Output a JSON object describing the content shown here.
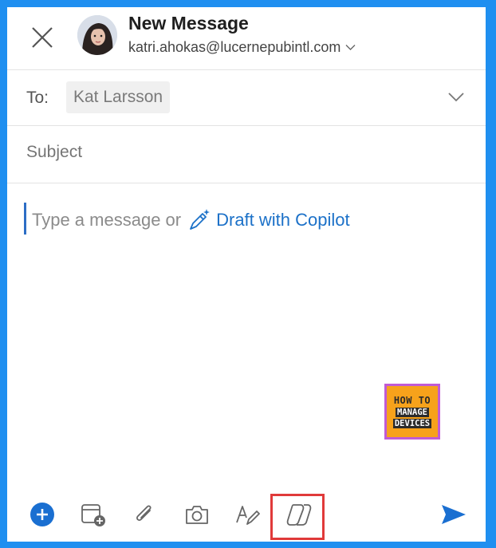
{
  "header": {
    "title": "New Message",
    "sender": "katri.ahokas@lucernepubintl.com"
  },
  "to": {
    "label": "To:",
    "recipient": "Kat Larsson"
  },
  "subject": {
    "placeholder": "Subject"
  },
  "body": {
    "placeholder": "Type a message or",
    "copilot_link": "Draft with Copilot"
  },
  "badge": {
    "line1": "HOW TO",
    "line2": "MANAGE",
    "line3": "DEVICES"
  },
  "toolbar": {
    "icons": [
      "add-icon",
      "calendar-add-icon",
      "attach-icon",
      "camera-icon",
      "draw-icon",
      "copilot-icon",
      "send-icon"
    ]
  },
  "colors": {
    "frame_border": "#1f8ff0",
    "accent": "#1c71c8",
    "highlight": "#e03a3a"
  }
}
